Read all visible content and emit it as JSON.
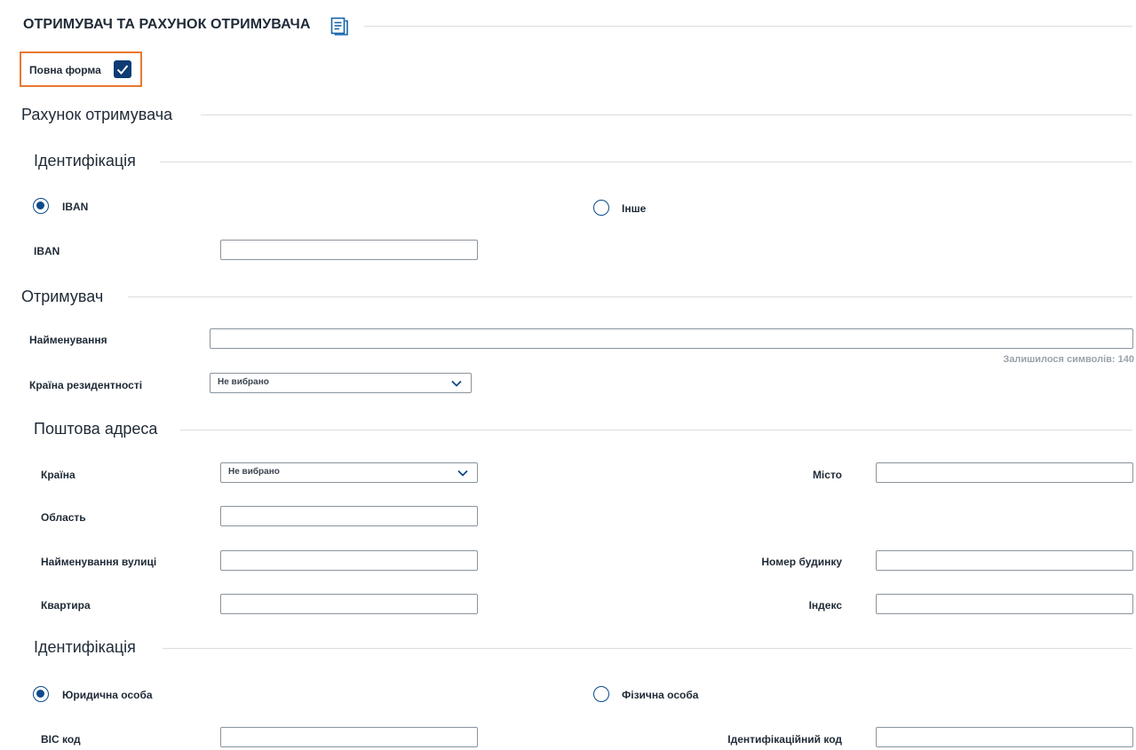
{
  "header": {
    "title": "ОТРИМУВАЧ ТА РАХУНОК ОТРИМУВАЧА",
    "full_form_label": "Повна форма",
    "full_form_checked": true
  },
  "account_section": {
    "title": "Рахунок отримувача",
    "identification": {
      "title": "Ідентифікація",
      "option_iban": "IBAN",
      "option_other": "Інше",
      "selected": "IBAN",
      "iban_label": "IBAN",
      "iban_value": ""
    }
  },
  "recipient_section": {
    "title": "Отримувач",
    "name_label": "Найменування",
    "name_value": "",
    "chars_left": "Залишилося символів: 140",
    "residence_country_label": "Країна резидентності",
    "residence_country_value": "Не вибрано"
  },
  "postal_section": {
    "title": "Поштова адреса",
    "country_label": "Країна",
    "country_value": "Не вибрано",
    "city_label": "Місто",
    "region_label": "Область",
    "street_label": "Найменування вулиці",
    "house_label": "Номер будинку",
    "apartment_label": "Квартира",
    "index_label": "Індекс"
  },
  "identification2": {
    "title": "Ідентифікація",
    "option_legal": "Юридична особа",
    "option_individual": "Фізична особа",
    "selected": "Юридична особа",
    "bic_label": "BIC код",
    "id_code_label": "Ідентифікаційний код"
  },
  "colors": {
    "accent": "#0b4a8b",
    "checkbox": "#0d3b74",
    "highlight": "#e8782f",
    "divider": "#d9dde2"
  }
}
